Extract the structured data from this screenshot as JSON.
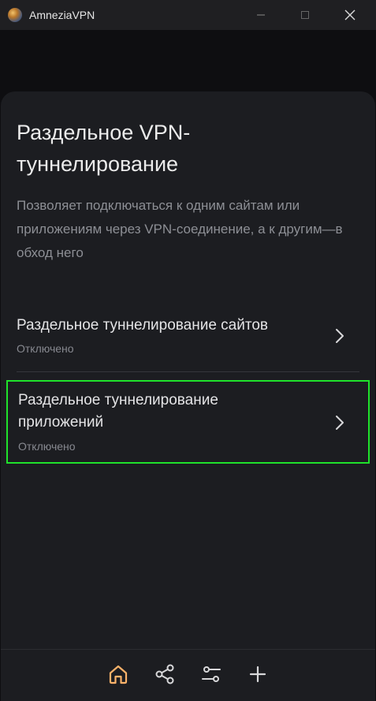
{
  "window": {
    "title": "AmneziaVPN"
  },
  "page": {
    "title": "Раздельное VPN-туннелирование",
    "description": "Позволяет подключаться к одним сайтам или приложениям через VPN-соединение, а к другим—в обход него"
  },
  "options": [
    {
      "label": "Раздельное туннелирование сайтов",
      "status": "Отключено"
    },
    {
      "label": "Раздельное туннелирование приложений",
      "status": "Отключено"
    }
  ],
  "nav": {
    "items": [
      "home-icon",
      "share-icon",
      "settings-icon",
      "add-icon"
    ],
    "active": "home-icon"
  },
  "colors": {
    "accent": "#fbb26a",
    "highlight": "#1fe22b",
    "background": "#0e0e11",
    "card": "#1c1d21"
  }
}
